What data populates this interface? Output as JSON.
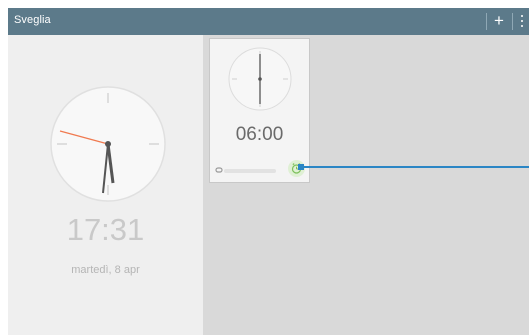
{
  "app": {
    "title": "Sveglia",
    "add_label": "+",
    "accent_color": "#5c7a8a"
  },
  "world_clock": {
    "time": "17:31",
    "date": "martedì, 8 apr",
    "hand_color_seconds": "#f07a50"
  },
  "alarm": {
    "time": "06:00",
    "days": "",
    "enabled_icon": "alarm-clock-icon",
    "toggle_color": "#dff0d4"
  },
  "callout_color": "#2b86c5"
}
